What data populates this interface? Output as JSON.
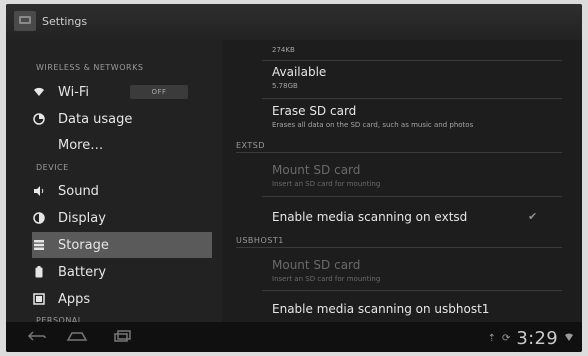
{
  "window": {
    "title": "Settings"
  },
  "sidebar": {
    "sections": [
      {
        "label": "WIRELESS & NETWORKS"
      },
      {
        "label": "DEVICE"
      },
      {
        "label": "PERSONAL"
      }
    ],
    "items": [
      {
        "label": "Wi-Fi",
        "icon": "wifi-icon",
        "toggle": "OFF"
      },
      {
        "label": "Data usage",
        "icon": "data-usage-icon"
      },
      {
        "label": "More…"
      },
      {
        "label": "Sound",
        "icon": "speaker-icon"
      },
      {
        "label": "Display",
        "icon": "display-icon"
      },
      {
        "label": "Storage",
        "icon": "storage-icon",
        "selected": true
      },
      {
        "label": "Battery",
        "icon": "battery-icon"
      },
      {
        "label": "Apps",
        "icon": "apps-icon"
      }
    ]
  },
  "main": {
    "top_size": "274KB",
    "available": {
      "title": "Available",
      "value": "5.78GB"
    },
    "erase": {
      "title": "Erase SD card",
      "subtitle": "Erases all data on the SD card, such as music and photos"
    },
    "sections": {
      "extsd": "EXTSD",
      "usbhost": "USBHOST1"
    },
    "mount_extsd": {
      "title": "Mount SD card",
      "subtitle": "Insert an SD card for mounting"
    },
    "enable_extsd": {
      "title": "Enable media scanning on extsd"
    },
    "mount_usbhost": {
      "title": "Mount SD card",
      "subtitle": "Insert an SD card for mounting"
    },
    "enable_usbhost": {
      "title": "Enable media scanning on usbhost1"
    }
  },
  "status": {
    "time": "3:29"
  },
  "colors": {
    "background": "#1d1d1d",
    "selected": "#5a5a5a"
  }
}
